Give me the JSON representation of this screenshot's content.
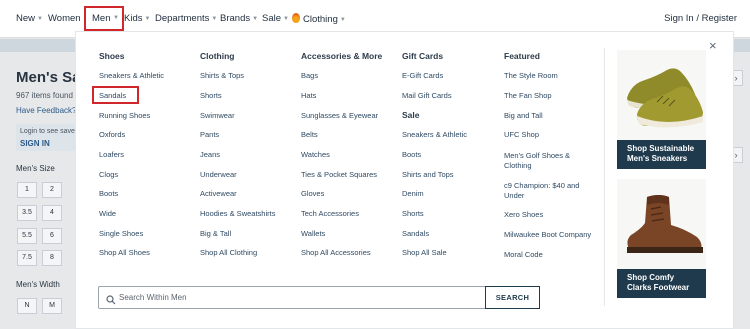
{
  "nav": {
    "items": [
      "New",
      "Women",
      "Men",
      "Kids",
      "Departments",
      "Brands",
      "Sale",
      "Clothing"
    ],
    "sign_in": "Sign In / Register"
  },
  "background": {
    "title": "Men's Sa",
    "count": "967 items found",
    "feedback": "Have Feedback?",
    "login_text": "Login to see save",
    "sign_in": "SIGN IN",
    "mens_size_label": "Men's Size",
    "sizes": [
      "1",
      "2",
      "3.5",
      "4",
      "5.5",
      "6",
      "7.5",
      "8"
    ],
    "mens_width_label": "Men's Width",
    "widths": [
      "N",
      "M"
    ]
  },
  "menu": {
    "close": "×",
    "columns": [
      {
        "heading": "Shoes",
        "links": [
          "Sneakers & Athletic",
          "Sandals",
          "Running Shoes",
          "Oxfords",
          "Loafers",
          "Clogs",
          "Boots",
          "Wide",
          "Single Shoes",
          "Shop All Shoes"
        ]
      },
      {
        "heading": "Clothing",
        "links": [
          "Shirts & Tops",
          "Shorts",
          "Swimwear",
          "Pants",
          "Jeans",
          "Underwear",
          "Activewear",
          "Hoodies & Sweatshirts",
          "Big & Tall",
          "Shop All Clothing"
        ]
      },
      {
        "heading": "Accessories & More",
        "links": [
          "Bags",
          "Hats",
          "Sunglasses & Eyewear",
          "Belts",
          "Watches",
          "Ties & Pocket Squares",
          "Gloves",
          "Tech Accessories",
          "Wallets",
          "Shop All Accessories"
        ]
      },
      {
        "heading": "Gift Cards",
        "links": [
          "E-Gift Cards",
          "Mail Gift Cards"
        ],
        "heading2": "Sale",
        "links2": [
          "Sneakers & Athletic",
          "Boots",
          "Shirts and Tops",
          "Denim",
          "Shorts",
          "Sandals",
          "Shop All Sale"
        ]
      },
      {
        "heading": "Featured",
        "links": [
          "The Style Room",
          "The Fan Shop",
          "Big and Tall",
          "UFC Shop",
          "Men's Golf Shoes &",
          "Clothing",
          "c9 Champion: $40 and",
          "Under",
          "Xero Shoes",
          "Milwaukee Boot Company",
          "Moral Code"
        ]
      }
    ],
    "promos": [
      {
        "line1": "Shop Sustainable",
        "line2": "Men's Sneakers"
      },
      {
        "line1": "Shop Comfy",
        "line2": "Clarks Footwear"
      }
    ],
    "search": {
      "placeholder": "Search Within Men",
      "button": "SEARCH"
    }
  }
}
